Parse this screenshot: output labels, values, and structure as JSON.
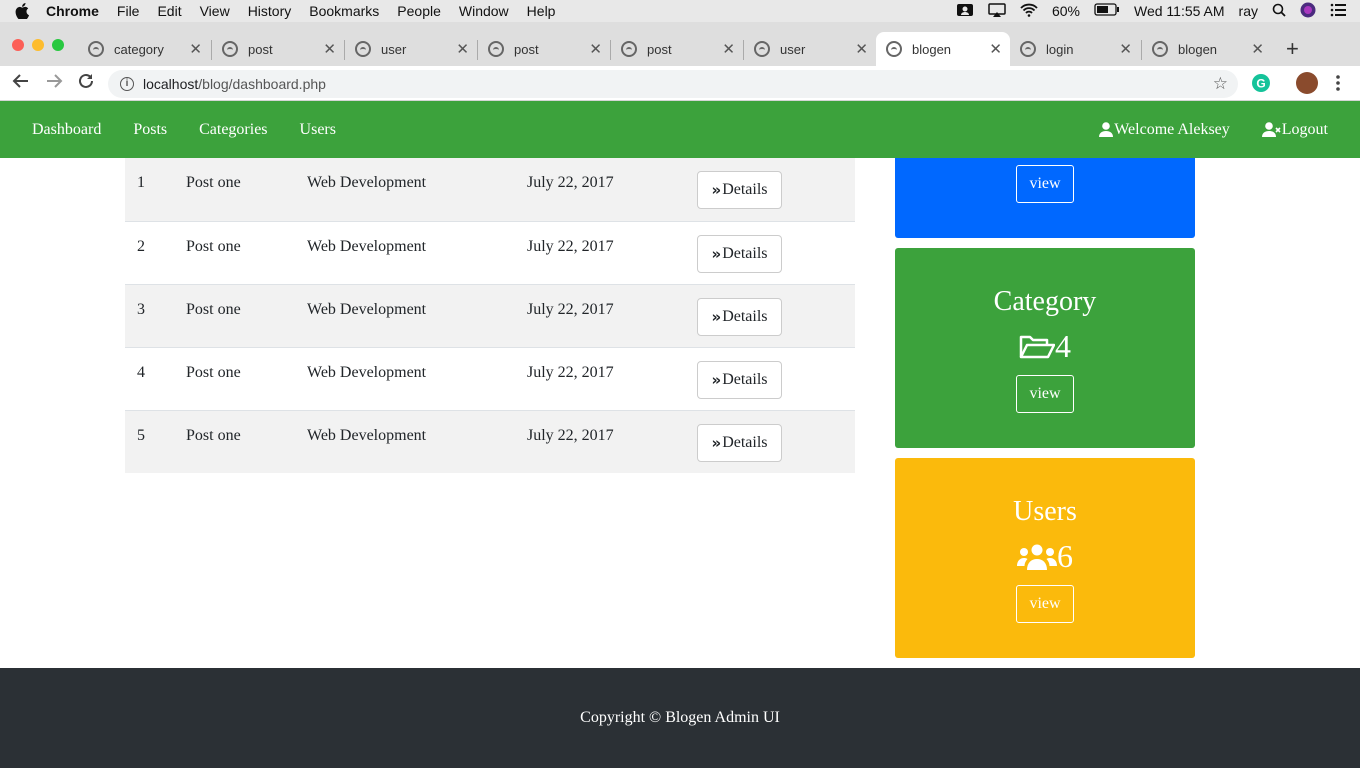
{
  "menubar": {
    "app": "Chrome",
    "items": [
      "File",
      "Edit",
      "View",
      "History",
      "Bookmarks",
      "People",
      "Window",
      "Help"
    ],
    "battery": "60%",
    "clock": "Wed 11:55 AM",
    "user": "ray"
  },
  "tabs": [
    {
      "label": "category",
      "active": false
    },
    {
      "label": "post",
      "active": false
    },
    {
      "label": "user",
      "active": false
    },
    {
      "label": "post",
      "active": false
    },
    {
      "label": "post",
      "active": false
    },
    {
      "label": "user",
      "active": false
    },
    {
      "label": "blogen",
      "active": true
    },
    {
      "label": "login",
      "active": false
    },
    {
      "label": "blogen",
      "active": false
    }
  ],
  "address": {
    "host": "localhost",
    "path": "/blog/dashboard.php"
  },
  "nav": {
    "links": [
      "Dashboard",
      "Posts",
      "Categories",
      "Users"
    ],
    "welcome": "Welcome Aleksey",
    "logout": "Logout"
  },
  "posts": [
    {
      "id": "1",
      "title": "Post one",
      "category": "Web Development",
      "date": "July 22, 2017",
      "action": "Details"
    },
    {
      "id": "2",
      "title": "Post one",
      "category": "Web Development",
      "date": "July 22, 2017",
      "action": "Details"
    },
    {
      "id": "3",
      "title": "Post one",
      "category": "Web Development",
      "date": "July 22, 2017",
      "action": "Details"
    },
    {
      "id": "4",
      "title": "Post one",
      "category": "Web Development",
      "date": "July 22, 2017",
      "action": "Details"
    },
    {
      "id": "5",
      "title": "Post one",
      "category": "Web Development",
      "date": "July 22, 2017",
      "action": "Details"
    }
  ],
  "cards": {
    "posts": {
      "view": "view",
      "color": "#0068ff"
    },
    "category": {
      "title": "Category",
      "count": "4",
      "view": "view",
      "color": "#3ca23c"
    },
    "users": {
      "title": "Users",
      "count": "6",
      "view": "view",
      "color": "#fbba0c"
    }
  },
  "footer": {
    "text": "Copyright © Blogen Admin UI"
  }
}
